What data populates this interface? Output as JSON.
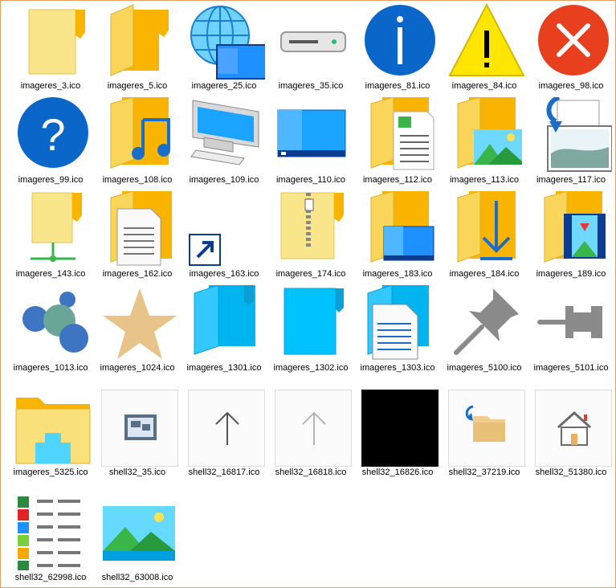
{
  "items": [
    {
      "label": "imageres_3.ico",
      "icon": "folder-icon"
    },
    {
      "label": "imageres_5.ico",
      "icon": "open-folder-icon"
    },
    {
      "label": "imageres_25.ico",
      "icon": "globe-network-icon"
    },
    {
      "label": "imageres_35.ico",
      "icon": "drive-icon"
    },
    {
      "label": "imageres_81.ico",
      "icon": "info-icon"
    },
    {
      "label": "imageres_84.ico",
      "icon": "warning-icon"
    },
    {
      "label": "imageres_98.ico",
      "icon": "error-icon"
    },
    {
      "label": "imageres_99.ico",
      "icon": "help-icon"
    },
    {
      "label": "imageres_108.ico",
      "icon": "music-folder-icon"
    },
    {
      "label": "imageres_109.ico",
      "icon": "computer-icon"
    },
    {
      "label": "imageres_110.ico",
      "icon": "desktop-icon"
    },
    {
      "label": "imageres_112.ico",
      "icon": "documents-folder-icon"
    },
    {
      "label": "imageres_113.ico",
      "icon": "pictures-folder-icon"
    },
    {
      "label": "imageres_117.ico",
      "icon": "image-import-icon"
    },
    {
      "label": "imageres_143.ico",
      "icon": "network-folder-icon"
    },
    {
      "label": "imageres_162.ico",
      "icon": "document-folder-icon"
    },
    {
      "label": "imageres_163.ico",
      "icon": "shortcut-arrow-icon"
    },
    {
      "label": "imageres_174.ico",
      "icon": "zip-folder-icon"
    },
    {
      "label": "imageres_183.ico",
      "icon": "desktop-folder-icon"
    },
    {
      "label": "imageres_184.ico",
      "icon": "downloads-folder-icon"
    },
    {
      "label": "imageres_189.ico",
      "icon": "videos-folder-icon"
    },
    {
      "label": "imageres_1013.ico",
      "icon": "people-bubbles-icon"
    },
    {
      "label": "imageres_1024.ico",
      "icon": "star-icon"
    },
    {
      "label": "imageres_1301.ico",
      "icon": "blue-open-folder-icon"
    },
    {
      "label": "imageres_1302.ico",
      "icon": "blue-folder-icon"
    },
    {
      "label": "imageres_1303.ico",
      "icon": "blue-document-folder-icon"
    },
    {
      "label": "imageres_5100.ico",
      "icon": "pin-icon"
    },
    {
      "label": "imageres_5101.ico",
      "icon": "pin-sideways-icon"
    },
    {
      "label": "imageres_5325.ico",
      "icon": "home-folder-icon"
    },
    {
      "label": "shell32_35.ico",
      "icon": "window-icon"
    },
    {
      "label": "shell32_16817.ico",
      "icon": "up-arrow-icon"
    },
    {
      "label": "shell32_16818.ico",
      "icon": "up-arrow-light-icon"
    },
    {
      "label": "shell32_16826.ico",
      "icon": "black-square-icon"
    },
    {
      "label": "shell32_37219.ico",
      "icon": "folder-return-icon"
    },
    {
      "label": "shell32_51380.ico",
      "icon": "house-icon"
    },
    {
      "label": "shell32_62998.ico",
      "icon": "color-list-icon"
    },
    {
      "label": "shell32_63008.ico",
      "icon": "landscape-image-icon"
    }
  ]
}
